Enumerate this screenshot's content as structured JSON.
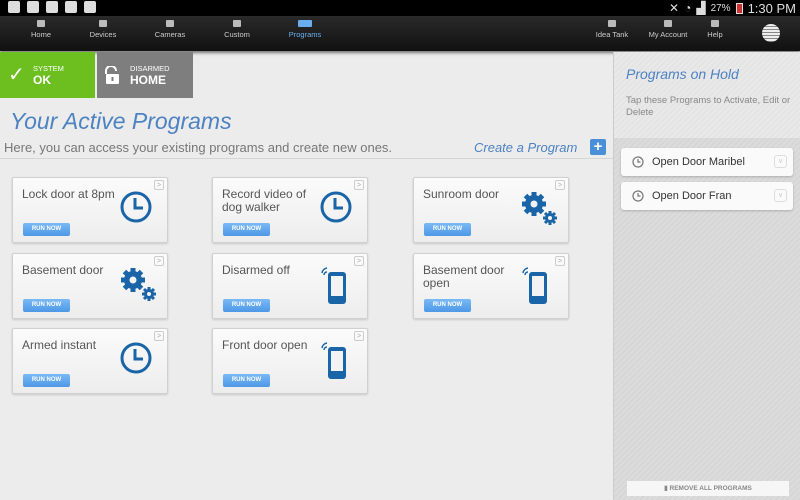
{
  "status_bar": {
    "battery": "27%",
    "time": "1:30 PM"
  },
  "nav": {
    "left": [
      {
        "label": "Home"
      },
      {
        "label": "Devices"
      },
      {
        "label": "Cameras"
      },
      {
        "label": "Custom"
      },
      {
        "label": "Programs",
        "active": true
      }
    ],
    "right": [
      {
        "label": "Idea Tank"
      },
      {
        "label": "My Account"
      },
      {
        "label": "Help"
      }
    ]
  },
  "system_tile": {
    "label": "SYSTEM",
    "value": "OK",
    "color": "#6cbf1f"
  },
  "arm_tile": {
    "label": "DISARMED",
    "value": "HOME"
  },
  "main": {
    "title": "Your Active Programs",
    "subtitle": "Here, you can access your existing programs and create new ones.",
    "create_label": "Create a Program",
    "run_label": "RUN NOW",
    "programs": [
      {
        "name": "Lock door at 8pm",
        "icon": "clock-icon"
      },
      {
        "name": "Record video of dog walker",
        "icon": "clock-icon"
      },
      {
        "name": "Sunroom door",
        "icon": "gears-icon"
      },
      {
        "name": "Basement door",
        "icon": "gears-icon"
      },
      {
        "name": "Disarmed off",
        "icon": "phone-icon"
      },
      {
        "name": "Basement door open",
        "icon": "phone-icon"
      },
      {
        "name": "Armed instant",
        "icon": "clock-icon"
      },
      {
        "name": "Front door open",
        "icon": "phone-icon"
      }
    ]
  },
  "hold_panel": {
    "title": "Programs on Hold",
    "description": "Tap these Programs to Activate, Edit or Delete",
    "items": [
      {
        "name": "Open Door Maribel"
      },
      {
        "name": "Open Door Fran"
      }
    ],
    "remove_label": "REMOVE ALL PROGRAMS"
  }
}
